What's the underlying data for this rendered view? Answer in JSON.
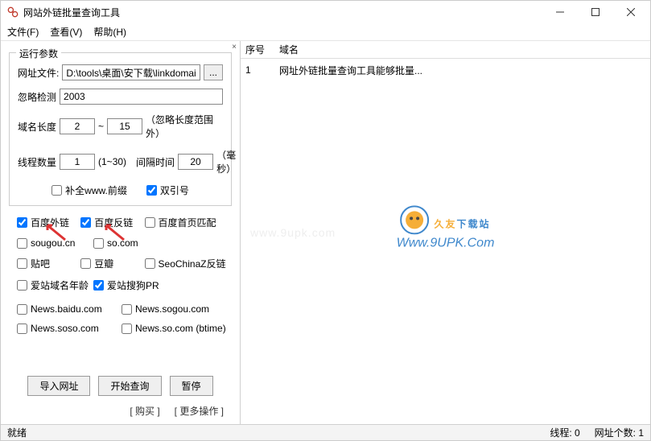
{
  "window": {
    "title": "网站外链批量查询工具"
  },
  "menu": {
    "file": "文件(F)",
    "view": "查看(V)",
    "help": "帮助(H)"
  },
  "panel": {
    "legend": "运行参数",
    "url_file_label": "网址文件:",
    "url_file_value": "D:\\tools\\桌面\\安下载\\linkdomain_v",
    "browse": "...",
    "ignore_detect_label": "忽略检测",
    "ignore_detect_value": "2003",
    "domain_len_label": "域名长度",
    "domain_len_min": "2",
    "domain_len_sep": "~",
    "domain_len_max": "15",
    "domain_len_note": "（忽略长度范围外）",
    "thread_label": "线程数量",
    "thread_value": "1",
    "thread_note": "(1~30)",
    "interval_label": "间隔时间",
    "interval_value": "20",
    "interval_unit": "（毫秒）",
    "cb_www": "补全www.前缀",
    "cb_quote": "双引号"
  },
  "checks": {
    "baidu_ext": "百度外链",
    "baidu_back": "百度反链",
    "baidu_home": "百度首页匹配",
    "sogou": "sougou.cn",
    "so": "so.com",
    "tieba": "贴吧",
    "douban": "豆瓣",
    "seochinaz": "SeoChinaZ反链",
    "aizhan_age": "爱站域名年龄",
    "aizhan_pr": "爱站搜狗PR",
    "news_baidu": "News.baidu.com",
    "news_sogou": "News.sogou.com",
    "news_soso": "News.soso.com",
    "news_so": "News.so.com (btime)"
  },
  "buttons": {
    "import": "导入网址",
    "start": "开始查询",
    "pause": "暂停",
    "buy": "[ 购买 ]",
    "more": "[ 更多操作 ]"
  },
  "list": {
    "col_idx": "序号",
    "col_domain": "域名",
    "rows": [
      {
        "idx": "1",
        "domain": "网址外链批量查询工具能够批量..."
      }
    ]
  },
  "status": {
    "ready": "就绪",
    "threads": "线程: 0",
    "count": "网址个数: 1"
  },
  "watermark": {
    "brand_a": "久友",
    "brand_b": "下载站",
    "url": "Www.9UPK.Com",
    "bg": "www.9upk.com"
  }
}
